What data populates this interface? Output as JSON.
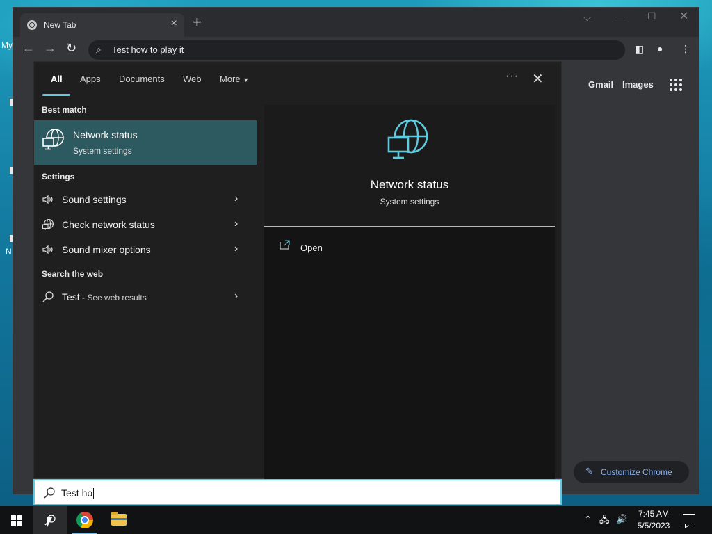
{
  "desktop": {
    "fragments": [
      "My",
      "N"
    ]
  },
  "browser": {
    "tab_title": "New Tab",
    "omnibox_text": "Test how to play it",
    "ntp": {
      "gmail": "Gmail",
      "images": "Images",
      "customize": "Customize Chrome"
    }
  },
  "search": {
    "tabs": [
      {
        "label": "All",
        "active": true
      },
      {
        "label": "Apps"
      },
      {
        "label": "Documents"
      },
      {
        "label": "Web"
      },
      {
        "label": "More"
      }
    ],
    "sections": {
      "best_match": "Best match",
      "settings": "Settings",
      "web": "Search the web"
    },
    "best_match": {
      "title": "Network status",
      "subtitle": "System settings"
    },
    "settings_items": [
      {
        "label": "Sound settings",
        "icon": "speaker-icon"
      },
      {
        "label": "Check network status",
        "icon": "globe-icon"
      },
      {
        "label": "Sound mixer options",
        "icon": "speaker-icon"
      }
    ],
    "web_result": {
      "term": "Test",
      "suffix": " - See web results"
    },
    "preview": {
      "title": "Network status",
      "subtitle": "System settings",
      "action": "Open"
    },
    "query": "Test ho",
    "accent": "#5ecbe0"
  },
  "taskbar": {
    "time": "7:45 AM",
    "date": "5/5/2023"
  }
}
